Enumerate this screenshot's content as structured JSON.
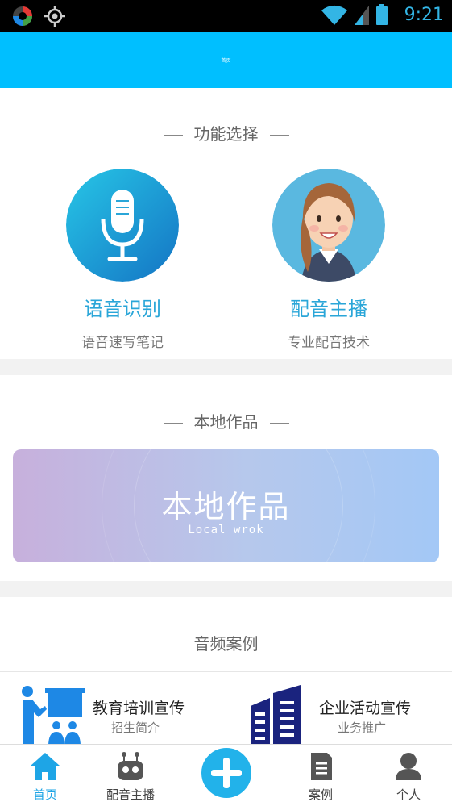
{
  "status_bar": {
    "time": "9:21",
    "icons": [
      "app-icon",
      "gps-icon",
      "wifi-icon",
      "signal-icon",
      "battery-icon"
    ]
  },
  "top_bar": {
    "title": "首页"
  },
  "function_section": {
    "heading": "功能选择",
    "items": [
      {
        "title": "语音识别",
        "subtitle": "语音速写笔记",
        "icon": "microphone-icon"
      },
      {
        "title": "配音主播",
        "subtitle": "专业配音技术",
        "icon": "female-anchor-avatar"
      }
    ]
  },
  "local_section": {
    "heading": "本地作品",
    "banner_title": "本地作品",
    "banner_subtitle": "Local wrok"
  },
  "cases_section": {
    "heading": "音频案例",
    "items": [
      {
        "title": "教育培训宣传",
        "subtitle": "招生简介",
        "icon": "teacher-icon"
      },
      {
        "title": "企业活动宣传",
        "subtitle": "业务推广",
        "icon": "building-icon"
      }
    ]
  },
  "bottom_nav": {
    "items": [
      {
        "label": "首页",
        "icon": "home-icon",
        "active": true
      },
      {
        "label": "配音主播",
        "icon": "robot-icon",
        "active": false
      },
      {
        "label": "",
        "icon": "plus-icon",
        "active": false
      },
      {
        "label": "案例",
        "icon": "document-icon",
        "active": false
      },
      {
        "label": "个人",
        "icon": "person-icon",
        "active": false
      }
    ]
  },
  "colors": {
    "accent": "#00bfff",
    "title_blue": "#2aa6d8",
    "nav_active": "#1ea5e6"
  }
}
